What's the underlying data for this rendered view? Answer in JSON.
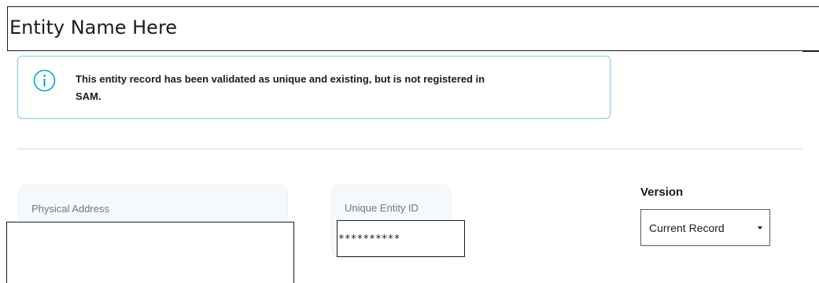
{
  "entity": {
    "name": "Entity Name Here"
  },
  "alert": {
    "icon": "info-icon",
    "message": "This entity record has been validated as unique and existing, but is not registered in SAM.",
    "border_color": "#8ed0df",
    "icon_color": "#00a6d2"
  },
  "physical_address": {
    "label": "Physical Address",
    "value": ""
  },
  "unique_entity_id": {
    "label": "Unique Entity ID",
    "value": "**********"
  },
  "version": {
    "label": "Version",
    "selected": "Current Record",
    "icon": "caret-down-icon"
  }
}
